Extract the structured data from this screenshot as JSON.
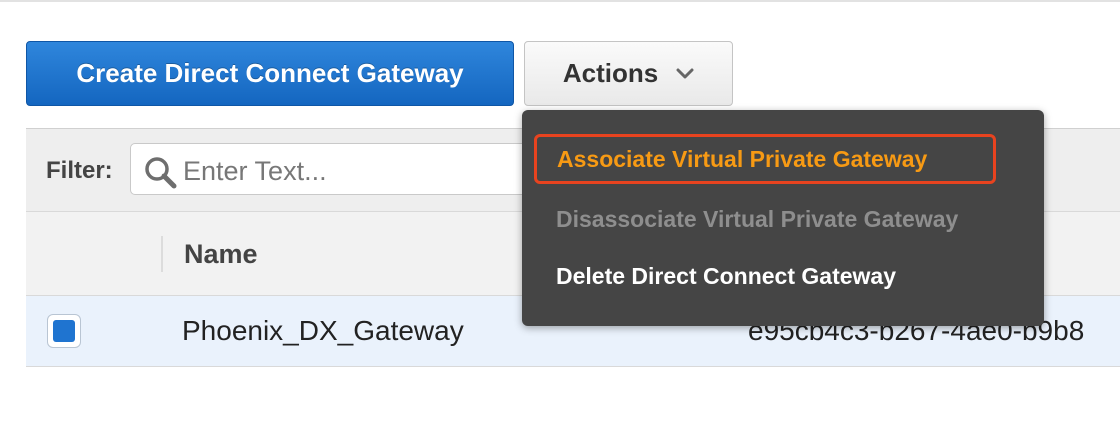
{
  "toolbar": {
    "create_label": "Create Direct Connect Gateway",
    "actions_label": "Actions"
  },
  "filter": {
    "label": "Filter:",
    "placeholder": "Enter Text..."
  },
  "table": {
    "columns": [
      "Name"
    ],
    "rows": [
      {
        "selected": true,
        "name": "Phoenix_DX_Gateway",
        "id_partial": "e95cb4c3-b267-4ae0-b9b8"
      }
    ]
  },
  "actions_menu": {
    "items": [
      {
        "label": "Associate Virtual Private Gateway",
        "state": "highlighted"
      },
      {
        "label": "Disassociate Virtual Private Gateway",
        "state": "disabled"
      },
      {
        "label": "Delete Direct Connect Gateway",
        "state": "enabled"
      }
    ]
  },
  "colors": {
    "primary_button": "#1f74d0",
    "menu_background": "#454545",
    "highlight_text": "#f79a14",
    "highlight_border": "#e8431f",
    "disabled_text": "#8e8e8e",
    "selected_row": "#eaf2fc"
  },
  "icons": {
    "search": "search-icon",
    "actions_chevron": "chevron-down-icon"
  }
}
